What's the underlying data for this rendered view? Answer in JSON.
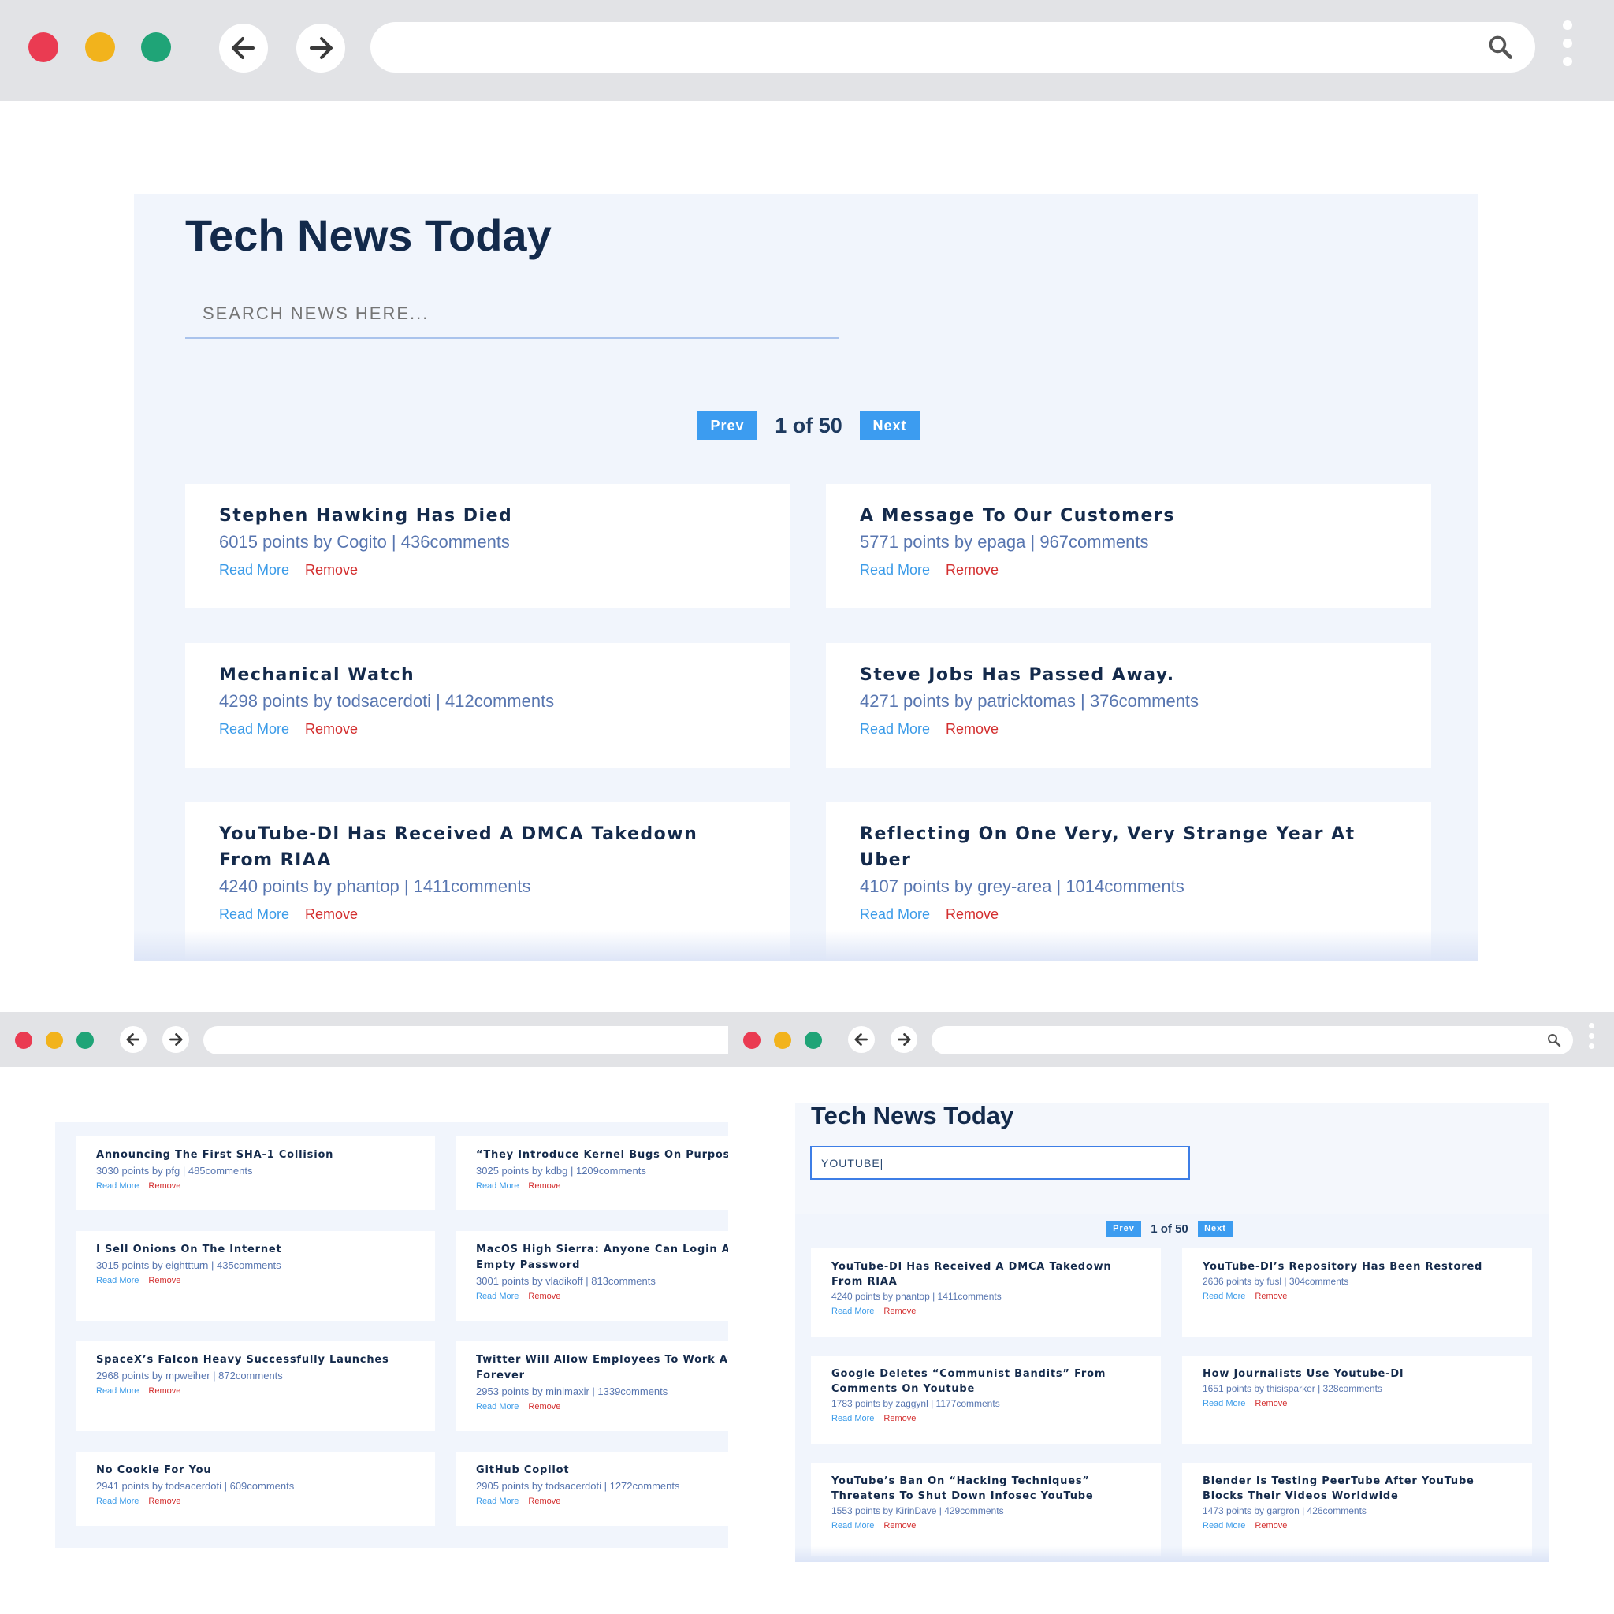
{
  "top": {
    "title": "Tech News Today",
    "search_placeholder": "SEARCH NEWS HERE...",
    "pager": {
      "prev": "Prev",
      "status": "1 of 50",
      "next": "Next"
    },
    "cards": [
      {
        "title": "Stephen Hawking Has Died",
        "meta": "6015 points by Cogito | 436comments"
      },
      {
        "title": "A Message To Our Customers",
        "meta": "5771 points by epaga | 967comments"
      },
      {
        "title": "Mechanical Watch",
        "meta": "4298 points by todsacerdoti | 412comments"
      },
      {
        "title": "Steve Jobs Has Passed Away.",
        "meta": "4271 points by patricktomas | 376comments"
      },
      {
        "title": "YouTube-Dl Has Received A DMCA Takedown From RIAA",
        "meta": "4240 points by phantop | 1411comments"
      },
      {
        "title": "Reflecting On One Very, Very Strange Year At Uber",
        "meta": "4107 points by grey-area | 1014comments"
      }
    ]
  },
  "bottom_left": {
    "cards": [
      {
        "title": "Announcing The First SHA-1 Collision",
        "meta": "3030 points by pfg | 485comments"
      },
      {
        "title": "“They Introduce Kernel Bugs On Purpose”",
        "meta": "3025 points by kdbg | 1209comments"
      },
      {
        "title": "I Sell Onions On The Internet",
        "meta": "3015 points by eighttturn | 435comments"
      },
      {
        "title": "MacOS High Sierra: Anyone Can Login As ‘ With Empty Password",
        "meta": "3001 points by vladikoff | 813comments"
      },
      {
        "title": "SpaceX’s Falcon Heavy Successfully Launches",
        "meta": "2968 points by mpweiher | 872comments"
      },
      {
        "title": "Twitter Will Allow Employees To Work At H Forever",
        "meta": "2953 points by minimaxir | 1339comments"
      },
      {
        "title": "No Cookie For You",
        "meta": "2941 points by todsacerdoti | 609comments"
      },
      {
        "title": "GitHub Copilot",
        "meta": "2905 points by todsacerdoti | 1272comments"
      }
    ]
  },
  "bottom_right": {
    "title": "Tech News Today",
    "search_value": "YOUTUBE|",
    "pager": {
      "prev": "Prev",
      "status": "1 of 50",
      "next": "Next"
    },
    "cards": [
      {
        "title": "YouTube-Dl Has Received A DMCA Takedown From RIAA",
        "meta": "4240 points by phantop | 1411comments"
      },
      {
        "title": "YouTube-Dl’s Repository Has Been Restored",
        "meta": "2636 points by fusl | 304comments"
      },
      {
        "title": "Google Deletes “Communist Bandits” From Comments On Youtube",
        "meta": "1783 points by zaggynl | 1177comments"
      },
      {
        "title": "How Journalists Use Youtube-Dl",
        "meta": "1651 points by thisisparker | 328comments"
      },
      {
        "title": "YouTube’s Ban On “Hacking Techniques” Threatens To Shut Down Infosec YouTube",
        "meta": "1553 points by KirinDave | 429comments"
      },
      {
        "title": "Blender Is Testing PeerTube After YouTube Blocks Their Videos Worldwide",
        "meta": "1473 points by gargron | 426comments"
      }
    ]
  },
  "labels": {
    "read_more": "Read More",
    "remove": "Remove"
  },
  "colors": {
    "chrome": "#e2e3e6",
    "close": "#ea3b52",
    "minimize": "#f2b31c",
    "maximize": "#1fa477",
    "accent": "#3c9cf0",
    "title": "#132a4b",
    "meta": "#5876b0",
    "remove": "#d32f2f",
    "panel": "#f1f5fc"
  },
  "icons": [
    "back-arrow-icon",
    "forward-arrow-icon",
    "search-icon",
    "more-vertical-icon"
  ]
}
